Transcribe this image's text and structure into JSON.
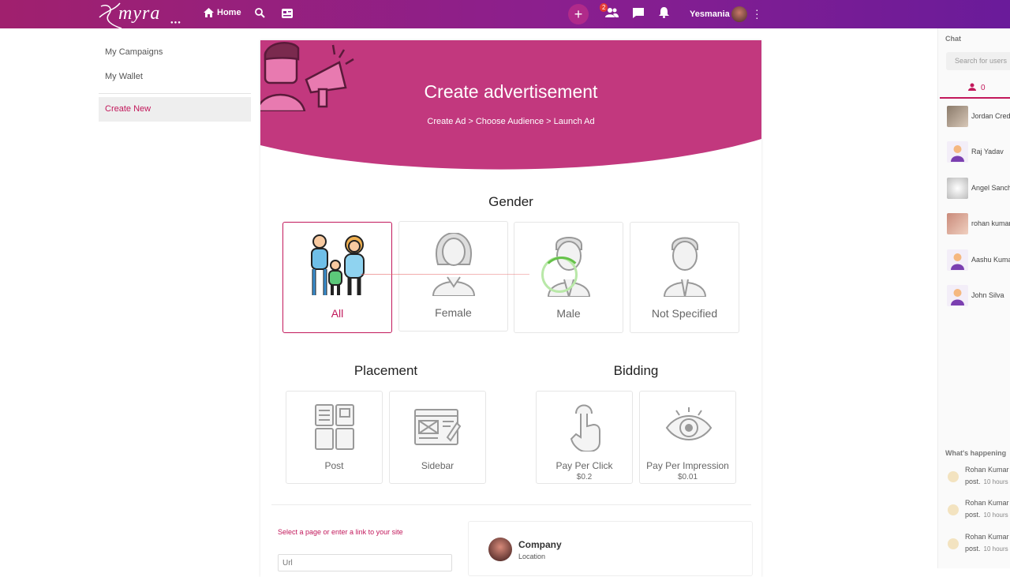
{
  "topbar": {
    "logo_text": "myra",
    "home_label": "Home",
    "friend_requests_count": "2",
    "username": "Yesmania",
    "colors": {
      "start": "#a0206e",
      "end": "#6a1b9a"
    }
  },
  "sidebar": {
    "items": [
      {
        "label": "My Campaigns"
      },
      {
        "label": "My Wallet"
      }
    ],
    "create_new": "Create New"
  },
  "hero": {
    "title": "Create advertisement",
    "breadcrumb": "Create Ad > Choose Audience > Launch Ad",
    "color": "#c2387e"
  },
  "gender": {
    "title": "Gender",
    "options": [
      {
        "label": "All",
        "selected": true
      },
      {
        "label": "Female",
        "selected": false
      },
      {
        "label": "Male",
        "selected": false
      },
      {
        "label": "Not Specified",
        "selected": false
      }
    ]
  },
  "placement": {
    "title": "Placement",
    "options": [
      {
        "label": "Post"
      },
      {
        "label": "Sidebar"
      }
    ]
  },
  "bidding": {
    "title": "Bidding",
    "options": [
      {
        "label": "Pay Per Click",
        "price": "$0.2"
      },
      {
        "label": "Pay Per Impression",
        "price": "$0.01"
      }
    ]
  },
  "link_section": {
    "hint": "Select a page or enter a link to your site",
    "url_placeholder": "Url"
  },
  "preview": {
    "name": "Company",
    "location": "Location"
  },
  "chat": {
    "title": "Chat",
    "search_placeholder": "Search for users",
    "online_count": "0",
    "users": [
      {
        "name": "Jordan Credo"
      },
      {
        "name": "Raj Yadav"
      },
      {
        "name": "Angel Sanchez"
      },
      {
        "name": "rohan kumar"
      },
      {
        "name": "Aashu Kumar"
      },
      {
        "name": "John Silva"
      }
    ],
    "whats_happening": "What's happening",
    "activity": [
      {
        "line1": "Rohan Kumar",
        "line2": "post.",
        "time": "10 hours"
      },
      {
        "line1": "Rohan Kumar",
        "line2": "post.",
        "time": "10 hours"
      },
      {
        "line1": "Rohan Kumar",
        "line2": "post.",
        "time": "10 hours"
      }
    ]
  }
}
